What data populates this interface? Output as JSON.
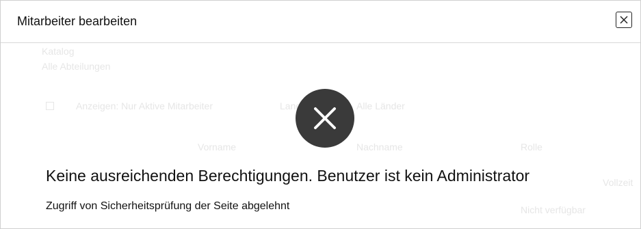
{
  "dialog": {
    "title": "Mitarbeiter bearbeiten",
    "close_icon": "close-icon"
  },
  "background": {
    "section_label": "Katalog",
    "section_value": "Alle Abteilungen",
    "checkbox_label": "Anzeigen: Nur Aktive Mitarbeiter",
    "filter_label": "Land",
    "filter_value": "Alle Länder",
    "col_first": "Vorname",
    "col_last": "Nachname",
    "col_role": "Rolle",
    "row_right": "Vollzeit",
    "row_right2": "Nicht verfügbar"
  },
  "error": {
    "icon": "error-x-icon",
    "heading": "Keine ausreichenden Berechtigungen. Benutzer ist kein Administrator",
    "detail": "Zugriff von Sicherheitsprüfung der Seite abgelehnt"
  },
  "colors": {
    "badge": "#3a3a3a",
    "divider": "#d8d8d8"
  }
}
